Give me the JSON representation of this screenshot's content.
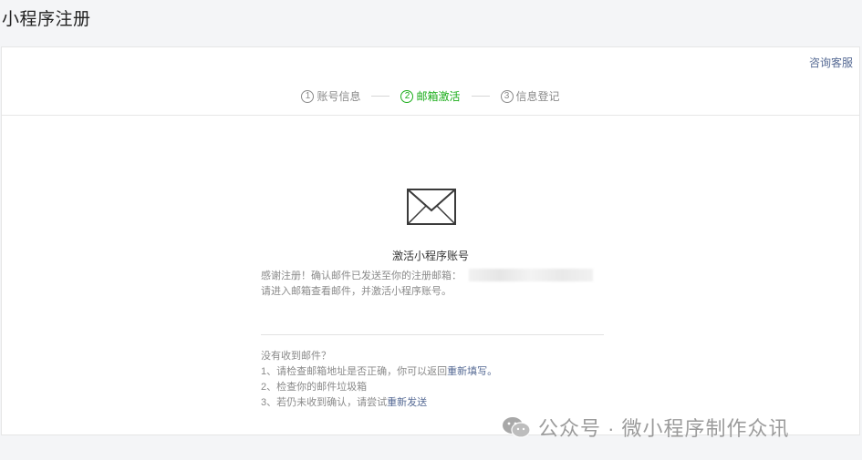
{
  "header": {
    "title": "小程序注册"
  },
  "help": {
    "label": "咨询客服"
  },
  "steps": [
    {
      "num": "1",
      "label": "账号信息",
      "state": "done"
    },
    {
      "num": "2",
      "label": "邮箱激活",
      "state": "active"
    },
    {
      "num": "3",
      "label": "信息登记",
      "state": "pending"
    }
  ],
  "activation": {
    "icon": "envelope-icon",
    "title": "激活小程序账号",
    "desc_part1": "感谢注册！确认邮件已发送至你的注册邮箱：",
    "desc_part2": "请进入邮箱查看邮件，并激活小程序账号。"
  },
  "tips": {
    "heading": "没有收到邮件？",
    "line1_prefix": "1、请检查邮箱地址是否正确，你可以返回",
    "line1_link": "重新填写。",
    "line2": "2、检查你的邮件垃圾箱",
    "line3_prefix": "3、若仍未收到确认，请尝试",
    "line3_link": "重新发送"
  },
  "watermark": {
    "icon": "wechat-icon",
    "text": "公众号 · 微小程序制作众讯"
  },
  "colors": {
    "accent_green": "#1aad19",
    "link_blue": "#576b95",
    "muted": "#8a8a8a"
  }
}
